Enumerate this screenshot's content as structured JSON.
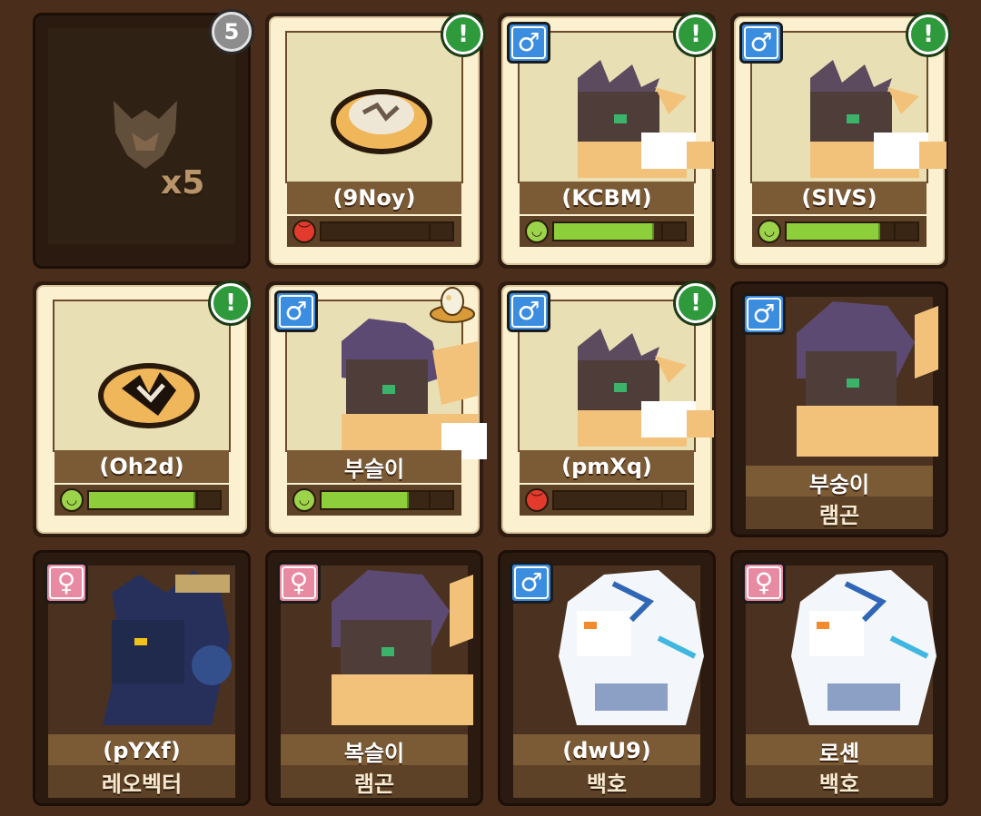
{
  "cards": [
    {
      "id": "c1",
      "stack_count_badge": "5",
      "stack_label": "x5"
    },
    {
      "id": "c2",
      "name": "(9Noy)",
      "mood": "angry",
      "mood_level": 0.0
    },
    {
      "id": "c3",
      "gender": "male",
      "name": "(KCBM)",
      "mood": "happy",
      "mood_level": 0.75
    },
    {
      "id": "c4",
      "gender": "male",
      "name": "(SlVS)",
      "mood": "happy",
      "mood_level": 0.7
    },
    {
      "id": "c5",
      "name": "(Oh2d)",
      "mood": "happy",
      "mood_level": 0.8
    },
    {
      "id": "c6",
      "gender": "male",
      "name": "부슬이",
      "mood": "happy",
      "mood_level": 0.65
    },
    {
      "id": "c7",
      "gender": "male",
      "name": "(pmXq)",
      "mood": "angry",
      "mood_level": 0.0
    },
    {
      "id": "c8",
      "gender": "male",
      "name": "부숭이",
      "species": "램곤"
    },
    {
      "id": "c9",
      "gender": "female",
      "name": "(pYXf)",
      "species": "레오벡터"
    },
    {
      "id": "c10",
      "gender": "female",
      "name": "복슬이",
      "species": "램곤"
    },
    {
      "id": "c11",
      "gender": "male",
      "name": "(dwU9)",
      "species": "백호"
    },
    {
      "id": "c12",
      "gender": "female",
      "name": "로셴",
      "species": "백호"
    }
  ],
  "symbols": {
    "alert": "!",
    "male": "♂",
    "female": "♀",
    "happy_face": "◡",
    "angry_face": "︶"
  },
  "colors": {
    "background": "#4a2e1b",
    "alert_green": "#2f9a3c",
    "male_blue": "#3b8de0",
    "female_pink": "#e98aa3",
    "mood_green": "#8ccf3a",
    "angry_red": "#e23b2e"
  }
}
